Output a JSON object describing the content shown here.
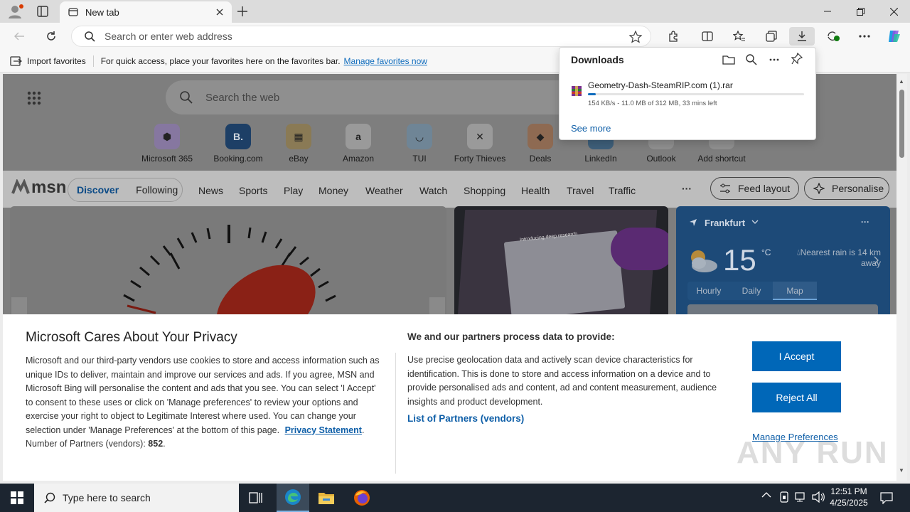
{
  "browser": {
    "tab_title": "New tab",
    "address_placeholder": "Search or enter web address",
    "favbar": {
      "import_label": "Import favorites",
      "message": "For quick access, place your favorites here on the favorites bar.",
      "manage_link": "Manage favorites now"
    }
  },
  "downloads": {
    "title": "Downloads",
    "file_name": "Geometry-Dash-SteamRIP.com (1).rar",
    "status": "154 KB/s - 11.0 MB of 312 MB, 33 mins left",
    "progress": 0.035,
    "see_more": "See more"
  },
  "newtab": {
    "search_placeholder": "Search the web",
    "shortcuts": [
      "Microsoft 365",
      "Booking.com",
      "eBay",
      "Amazon",
      "TUI",
      "Forty Thieves",
      "Deals",
      "LinkedIn",
      "Outlook",
      "Add shortcut"
    ],
    "msn": {
      "logo": "msn",
      "tabs": [
        "Discover",
        "Following"
      ],
      "nav": [
        "News",
        "Sports",
        "Play",
        "Money",
        "Weather",
        "Watch",
        "Shopping",
        "Health",
        "Travel",
        "Traffic"
      ],
      "more": "···",
      "feed_layout": "Feed layout",
      "personalise": "Personalise"
    },
    "weather": {
      "city": "Frankfurt",
      "temp": "15",
      "unit": "°C",
      "rain": "Nearest rain is 14 km away",
      "tabs": [
        "Hourly",
        "Daily",
        "Map"
      ]
    },
    "card_text": "Introducing deep research"
  },
  "privacy": {
    "title": "Microsoft Cares About Your Privacy",
    "body": "Microsoft and our third-party vendors use cookies to store and access information such as unique IDs to deliver, maintain and improve our services and ads. If you agree, MSN and Microsoft Bing will personalise the content and ads that you see. You can select 'I Accept' to consent to these uses or click on 'Manage preferences' to review your options and exercise your right to object to Legitimate Interest where used. You can change your selection under 'Manage Preferences' at the bottom of this page.",
    "privacy_link": "Privacy Statement",
    "partners_label": "Number of Partners (vendors):",
    "partners_count": "852",
    "purpose_title": "We and our partners process data to provide:",
    "purpose_body": "Use precise geolocation data and actively scan device characteristics for identification. This is done to store and access information on a device and to provide personalised ads and content, ad and content measurement, audience insights and product development.",
    "partners_link": "List of Partners (vendors)",
    "accept": "I Accept",
    "reject": "Reject All",
    "manage": "Manage Preferences"
  },
  "taskbar": {
    "search_placeholder": "Type here to search",
    "time": "12:51 PM",
    "date": "4/25/2025"
  },
  "watermark": "ANY RUN",
  "colors": {
    "accent": "#0067b8",
    "link": "#0f6cbd"
  }
}
